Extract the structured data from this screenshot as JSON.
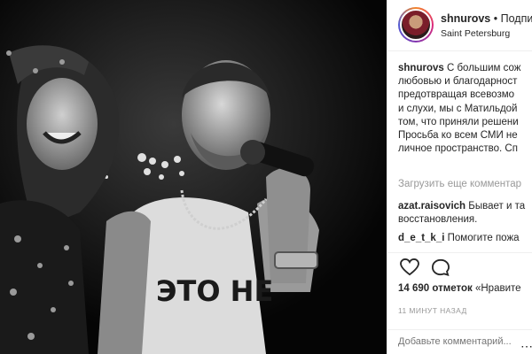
{
  "post": {
    "username": "shnurovs",
    "dot": "•",
    "follow_label": "Подпи",
    "location": "Saint Petersburg"
  },
  "caption": {
    "user": "shnurovs",
    "lines": [
      "С большим сож",
      "любовью и благодарност",
      "предотвращая всевозмо",
      "и слухи, мы с Матильдой",
      "том, что приняли решени",
      "Просьба ко всем СМИ не",
      "личное пространство. Сп"
    ]
  },
  "load_more": "Загрузить еще комментар",
  "comments": [
    {
      "user": "azat.raisovich",
      "text": "Бывает и та",
      "text2": "восстановления."
    },
    {
      "user": "d_e_t_k_i",
      "text": "Помогите пожа"
    }
  ],
  "icons": {
    "heart": "heart-icon",
    "comment": "comment-icon",
    "more": "more-options-icon"
  },
  "likes": {
    "count": "14 690 отметок",
    "label": "«Нравите"
  },
  "timestamp": "11 МИНУТ НАЗАД",
  "add_comment": {
    "placeholder": "Добавьте комментарий..."
  },
  "photo": {
    "shirt_text": "ЭТО НЕ"
  }
}
